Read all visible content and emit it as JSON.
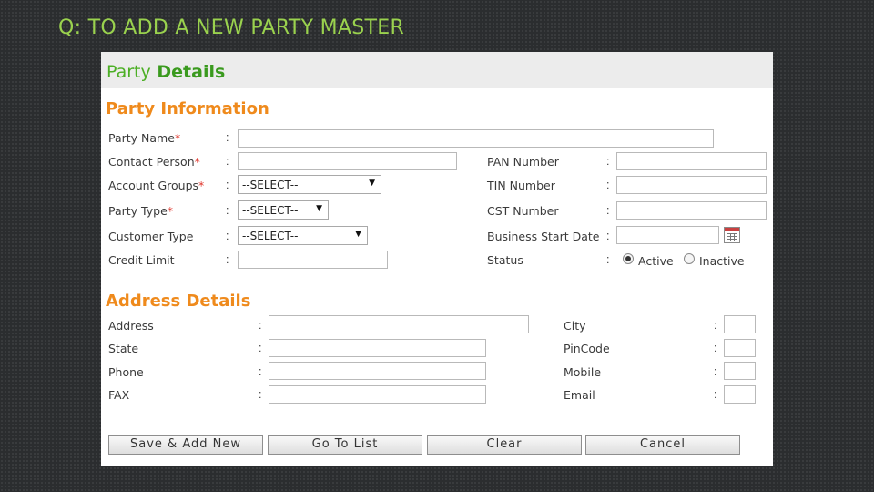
{
  "slide": {
    "title": "Q: TO ADD A NEW PARTY MASTER"
  },
  "panel": {
    "title_word1": "Party",
    "title_word2": "Details"
  },
  "party_info": {
    "title": "Party Information",
    "party_name": {
      "label": "Party Name",
      "required": "*",
      "value": ""
    },
    "contact_person": {
      "label": "Contact Person",
      "required": "*",
      "value": ""
    },
    "account_groups": {
      "label": "Account Groups",
      "required": "*",
      "selected": "--SELECT--"
    },
    "party_type": {
      "label": "Party Type",
      "required": "*",
      "selected": "--SELECT--"
    },
    "customer_type": {
      "label": "Customer Type",
      "selected": "--SELECT--"
    },
    "credit_limit": {
      "label": "Credit Limit",
      "value": ""
    },
    "pan_number": {
      "label": "PAN Number",
      "value": ""
    },
    "tin_number": {
      "label": "TIN Number",
      "value": ""
    },
    "cst_number": {
      "label": "CST Number",
      "value": ""
    },
    "business_start_date": {
      "label": "Business Start Date",
      "value": ""
    },
    "status": {
      "label": "Status",
      "options": [
        "Active",
        "Inactive"
      ],
      "selected": "Active"
    }
  },
  "address": {
    "title": "Address Details",
    "address": {
      "label": "Address",
      "value": ""
    },
    "state": {
      "label": "State",
      "value": ""
    },
    "phone": {
      "label": "Phone",
      "value": ""
    },
    "fax": {
      "label": "FAX",
      "value": ""
    },
    "city": {
      "label": "City",
      "value": ""
    },
    "pincode": {
      "label": "PinCode",
      "value": ""
    },
    "mobile": {
      "label": "Mobile",
      "value": ""
    },
    "email": {
      "label": "Email",
      "value": ""
    }
  },
  "colon": ":",
  "dropdown_arrow": "▼",
  "buttons": {
    "save_add_new": "Save & Add New",
    "go_to_list": "Go To List",
    "clear": "Clear",
    "cancel": "Cancel"
  },
  "colors": {
    "title_green": "#9ad24e",
    "header_green": "#4caf25",
    "section_orange": "#ef8a1c",
    "required_red": "#e0362c"
  }
}
